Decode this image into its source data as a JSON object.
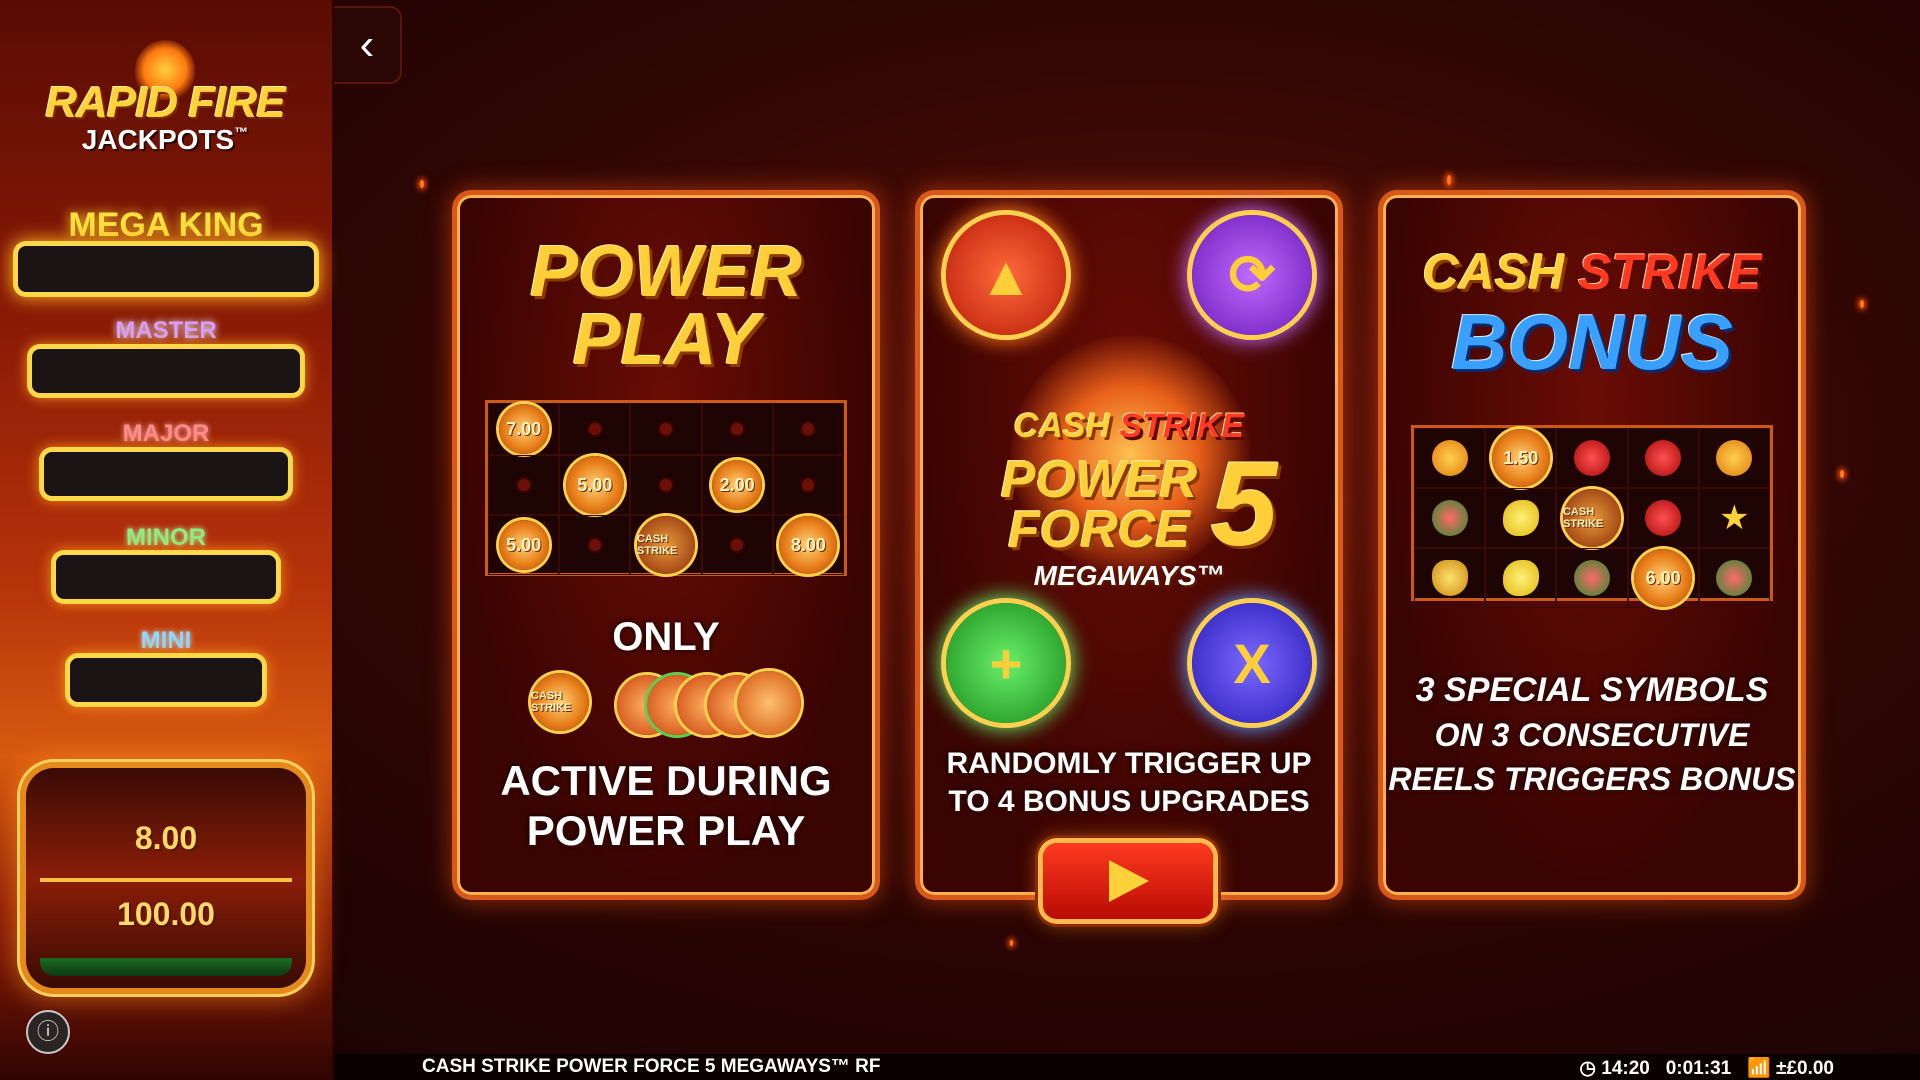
{
  "sidebar": {
    "logo_line1": "RAPID FIRE",
    "logo_line2": "JACKPOTS",
    "tm": "™",
    "jackpots": [
      {
        "label": "MEGA KING"
      },
      {
        "label": "MASTER"
      },
      {
        "label": "MAJOR"
      },
      {
        "label": "MINOR"
      },
      {
        "label": "MINI"
      }
    ],
    "bet_options": [
      "8.00",
      "100.00"
    ],
    "info_icon": "info-icon"
  },
  "nav": {
    "back_icon": "chevron-left-icon",
    "back_glyph": "‹"
  },
  "card1": {
    "title_line1": "POWER",
    "title_line2": "PLAY",
    "grid_values": [
      "7.00",
      "5.00",
      "5.00",
      "2.00",
      "8.00"
    ],
    "cash_strike": "CASH STRIKE",
    "only": "ONLY",
    "caption_line1": "ACTIVE DURING",
    "caption_line2": "POWER PLAY"
  },
  "card2": {
    "logo_line1_a": "CASH",
    "logo_line1_b": "STRIKE",
    "logo_line2": "POWER",
    "logo_line3": "FORCE",
    "logo_num": "5",
    "logo_line4": "MEGAWAYS™",
    "orbs": [
      "▲",
      "⟳",
      "+",
      "X"
    ],
    "caption_line1": "RANDOMLY TRIGGER UP",
    "caption_line2": "TO 4 BONUS UPGRADES",
    "play_icon": "play-icon"
  },
  "card3": {
    "title_cash": "CASH",
    "title_strike": "STRIKE",
    "title_bonus": "BONUS",
    "grid_values": [
      "1.50",
      "6.00"
    ],
    "cash_strike": "CASH STRIKE",
    "caption_line1": "3 SPECIAL SYMBOLS",
    "caption_line2": "ON 3 CONSECUTIVE",
    "caption_line3": "REELS TRIGGERS BONUS"
  },
  "footer": {
    "game_name": "CASH STRIKE POWER FORCE 5 MEGAWAYS™ RF",
    "clock": "14:20",
    "session_time": "0:01:31",
    "net": "±£0.00"
  },
  "colors": {
    "accent": "#ffcf3a",
    "frame": "#d8581a",
    "background": "#300604"
  }
}
